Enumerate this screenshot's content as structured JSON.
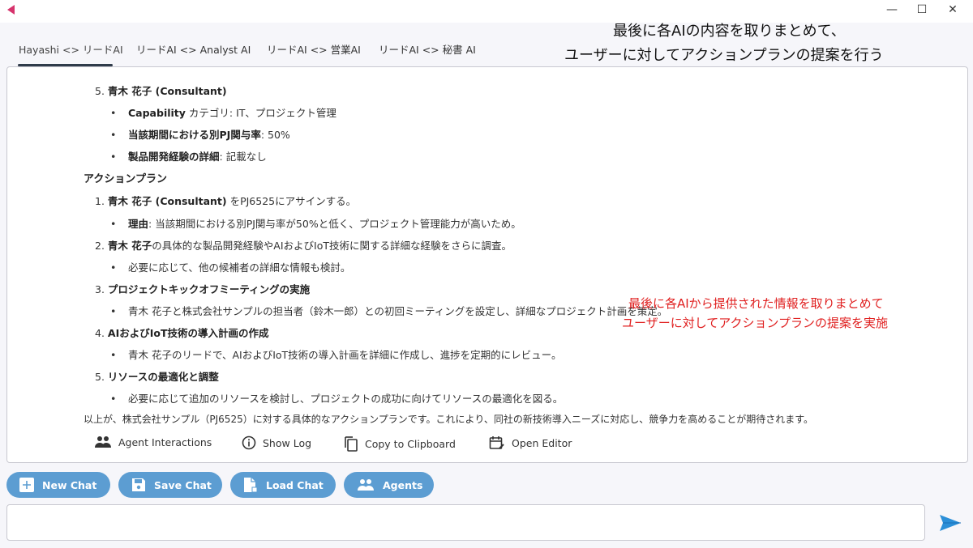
{
  "window": {
    "minimize": "—",
    "maximize": "☐",
    "close": "✕"
  },
  "tabs": [
    "Hayashi <> リードAI",
    "リードAI <> Analyst AI",
    "リードAI <> 営業AI",
    "リードAI <> 秘書 AI"
  ],
  "content": {
    "l1": {
      "num": "5. ",
      "bold": "青木 花子 (Consultant)",
      "rest": ""
    },
    "l2": {
      "bold": "Capability",
      "rest": " カテゴリ: IT、プロジェクト管理"
    },
    "l3": {
      "bold": "当該期間における別PJ関与率",
      "rest": ": 50%"
    },
    "l4": {
      "bold": "製品開発経験の詳細",
      "rest": ": 記載なし"
    },
    "heading": "アクションプラン",
    "a1": {
      "num": "1. ",
      "bold": "青木 花子 (Consultant)",
      "rest": " をPJ6525にアサインする。"
    },
    "a1b": {
      "bold": "理由",
      "rest": ": 当該期間における別PJ関与率が50%と低く、プロジェクト管理能力が高いため。"
    },
    "a2": {
      "num": "2. ",
      "bold": "青木 花子",
      "rest": "の具体的な製品開発経験やAIおよびIoT技術に関する詳細な経験をさらに調査。"
    },
    "a2b": "必要に応じて、他の候補者の詳細な情報も検討。",
    "a3": {
      "num": "3. ",
      "bold": "プロジェクトキックオフミーティングの実施"
    },
    "a3b": "青木 花子と株式会社サンプルの担当者（鈴木一郎）との初回ミーティングを設定し、詳細なプロジェクト計画を策定。",
    "a4": {
      "num": "4. ",
      "bold": "AIおよびIoT技術の導入計画の作成"
    },
    "a4b": "青木 花子のリードで、AIおよびIoT技術の導入計画を詳細に作成し、進捗を定期的にレビュー。",
    "a5": {
      "num": "5. ",
      "bold": "リソースの最適化と調整"
    },
    "a5b": "必要に応じて追加のリソースを検討し、プロジェクトの成功に向けてリソースの最適化を図る。",
    "summary": "以上が、株式会社サンプル（PJ6525）に対する具体的なアクションプランです。これにより、同社の新技術導入ニーズに対応し、競争力を高めることが期待されます。",
    "bullet": "•"
  },
  "actions": {
    "agent_interactions": "Agent Interactions",
    "show_log": "Show Log",
    "copy": "Copy to Clipboard",
    "open_editor": "Open Editor"
  },
  "buttons": {
    "new_chat": "New Chat",
    "save_chat": "Save Chat",
    "load_chat": "Load Chat",
    "agents": "Agents"
  },
  "input": {
    "value": ""
  },
  "annotations": {
    "top": [
      "最後に各AIの内容を取りまとめて、",
      "ユーザーに対してアクションプランの提案を行う"
    ],
    "red": [
      "最後に各AIから提供された情報を取りまとめて",
      "ユーザーに対してアクションプランの提案を実施"
    ]
  },
  "colors": {
    "accent": "#5c9dd2",
    "annotation_red": "#e02020",
    "send": "#2b8fd8"
  }
}
